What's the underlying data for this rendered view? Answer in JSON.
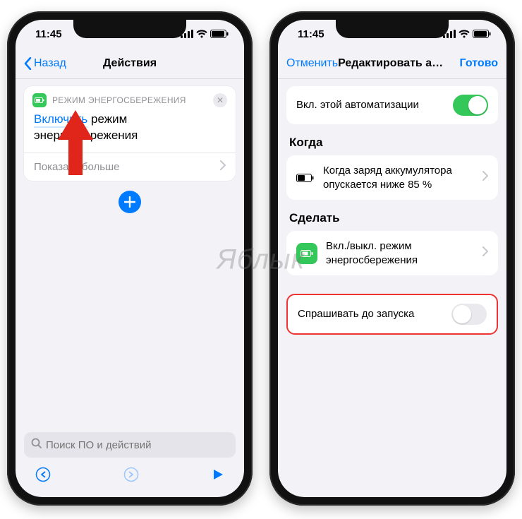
{
  "status": {
    "time": "11:45"
  },
  "left": {
    "nav": {
      "back": "Назад",
      "title": "Действия"
    },
    "action": {
      "header": "РЕЖИМ ЭНЕРГОСБЕРЕЖЕНИЯ",
      "highlight": "Включить",
      "rest1": " режим",
      "rest2": "энергосбережения",
      "show_more": "Показать больше"
    },
    "search_placeholder": "Поиск ПО и действий"
  },
  "right": {
    "nav": {
      "cancel": "Отменить",
      "title": "Редактировать автомати...",
      "done": "Готово"
    },
    "enable_label": "Вкл. этой автоматизации",
    "when_header": "Когда",
    "when_text": "Когда заряд аккумулятора опускается ниже 85 %",
    "do_header": "Сделать",
    "do_text": "Вкл./выкл. режим энергосбережения",
    "ask_label": "Спрашивать до запуска"
  },
  "watermark": "Яблык"
}
